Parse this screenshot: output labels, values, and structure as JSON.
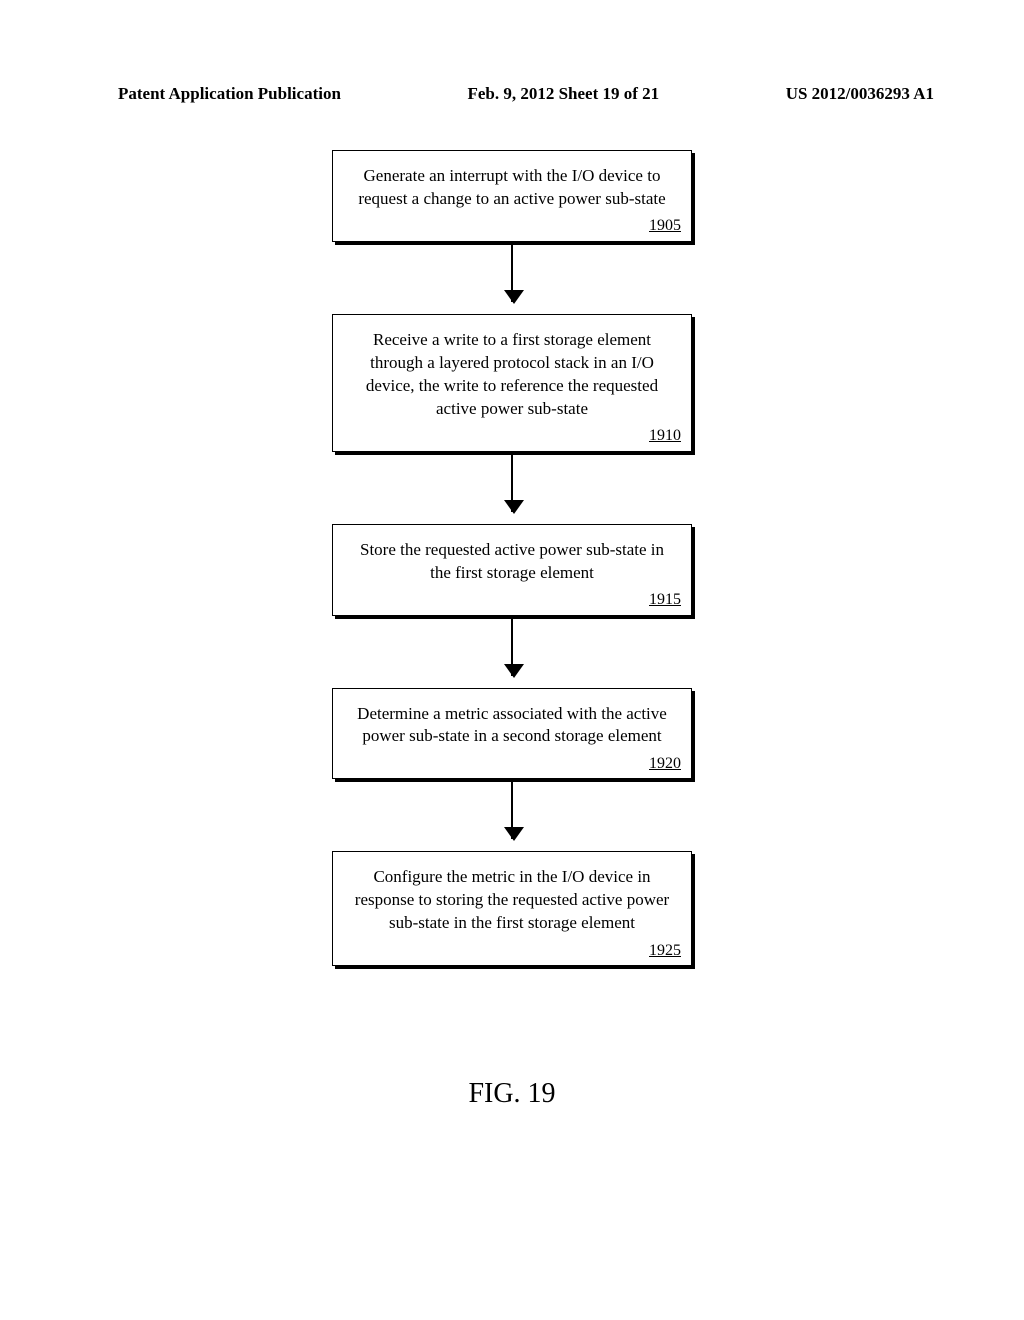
{
  "header": {
    "left": "Patent Application Publication",
    "center": "Feb. 9, 2012   Sheet 19 of 21",
    "right": "US 2012/0036293 A1"
  },
  "flow": {
    "steps": [
      {
        "text": "Generate an interrupt with the I/O device to request a change to an active power sub-state",
        "ref": "1905"
      },
      {
        "text": "Receive a write to a first storage element through a layered protocol stack in an I/O device, the write to reference the requested active power sub-state",
        "ref": "1910"
      },
      {
        "text": "Store the requested active power sub-state in the first storage element",
        "ref": "1915"
      },
      {
        "text": "Determine a metric associated with the active power sub-state in a second storage element",
        "ref": "1920"
      },
      {
        "text": "Configure the metric in the  I/O device in response to storing the requested active power sub-state in the first storage element",
        "ref": "1925"
      }
    ]
  },
  "figure_label": "FIG. 19"
}
